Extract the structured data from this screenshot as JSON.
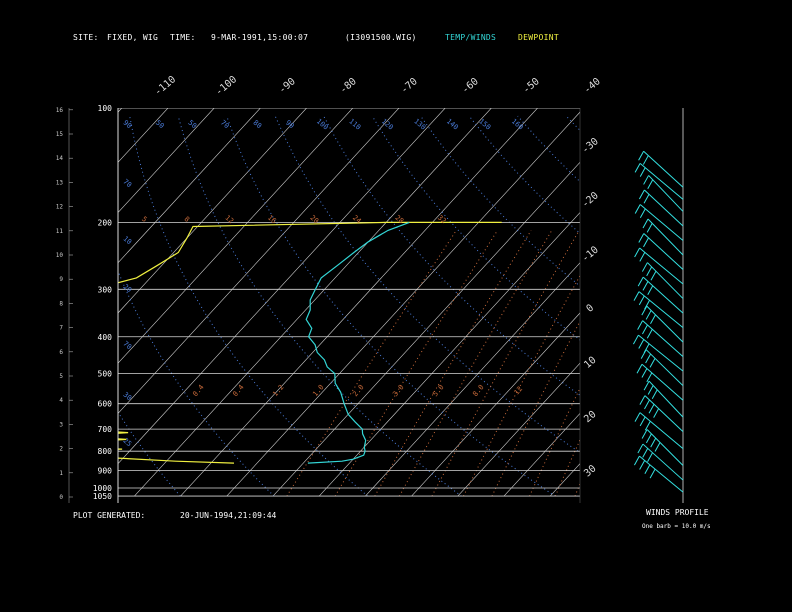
{
  "header": {
    "site_label": "SITE:",
    "site_value": "FIXED, WIG",
    "time_label": "TIME:",
    "time_value": "9-MAR-1991,15:00:07",
    "file_value": "(I3091500.WIG)",
    "temp_winds_label": "TEMP/WINDS",
    "dewpoint_label": "DEWPOINT"
  },
  "footer": {
    "generated_label": "PLOT GENERATED:",
    "generated_value": "20-JUN-1994,21:09:44",
    "winds_profile_label": "WINDS PROFILE",
    "barb_note": "One barb = 10.0 m/s"
  },
  "colors": {
    "background": "#000000",
    "temperature": "#33d6d6",
    "dewpoint": "#f0f040",
    "isobar": "#d8d8d8",
    "isotherm": "#cfcfcf",
    "dry_adiabat": "#4a7bd8",
    "mixing_ratio": "#c86a3a",
    "wind_barb": "#33e0e0"
  },
  "chart_data": {
    "type": "skew-t",
    "pressure_levels_hPa": [
      100,
      200,
      300,
      400,
      500,
      600,
      700,
      800,
      900,
      1000,
      1050
    ],
    "height_km_ticks": [
      0,
      1,
      2,
      3,
      4,
      5,
      6,
      7,
      8,
      9,
      10,
      11,
      12,
      13,
      14,
      15,
      16
    ],
    "isotherm_labels_C": [
      "-110",
      "-100",
      "-90",
      "-80",
      "-70",
      "-60",
      "-50",
      "-40",
      "-30",
      "-20",
      "-10",
      "0",
      "10",
      "20",
      "30"
    ],
    "theta_labels_K": [
      "90",
      "50",
      "50",
      "70",
      "80",
      "90",
      "100",
      "110",
      "120",
      "130",
      "140",
      "150",
      "160"
    ],
    "theta_labels_lower": [
      "70",
      "10",
      "20",
      "70",
      "30",
      "25"
    ],
    "mixing_ratio_labels_upper": [
      "5",
      "8",
      "12",
      "16",
      "20",
      "24",
      "28",
      "32"
    ],
    "mixing_ratio_labels_lower": [
      "0.4",
      "0.4",
      "1.2",
      "1.0",
      "2.0",
      "3.0",
      "5.0",
      "8.0",
      "12"
    ],
    "temperature_profile": [
      {
        "p": 860,
        "t": -29
      },
      {
        "p": 850,
        "t": -22
      },
      {
        "p": 840,
        "t": -20
      },
      {
        "p": 820,
        "t": -18.5
      },
      {
        "p": 800,
        "t": -19
      },
      {
        "p": 780,
        "t": -20
      },
      {
        "p": 750,
        "t": -21
      },
      {
        "p": 720,
        "t": -23
      },
      {
        "p": 700,
        "t": -24
      },
      {
        "p": 670,
        "t": -27
      },
      {
        "p": 640,
        "t": -30
      },
      {
        "p": 600,
        "t": -33
      },
      {
        "p": 560,
        "t": -36
      },
      {
        "p": 530,
        "t": -39
      },
      {
        "p": 500,
        "t": -41
      },
      {
        "p": 480,
        "t": -44
      },
      {
        "p": 460,
        "t": -46
      },
      {
        "p": 440,
        "t": -49
      },
      {
        "p": 420,
        "t": -51
      },
      {
        "p": 400,
        "t": -54
      },
      {
        "p": 380,
        "t": -55
      },
      {
        "p": 360,
        "t": -58
      },
      {
        "p": 340,
        "t": -59
      },
      {
        "p": 320,
        "t": -61
      },
      {
        "p": 300,
        "t": -62
      },
      {
        "p": 280,
        "t": -63
      },
      {
        "p": 260,
        "t": -62
      },
      {
        "p": 240,
        "t": -61
      },
      {
        "p": 225,
        "t": -60
      },
      {
        "p": 210,
        "t": -58
      },
      {
        "p": 200,
        "t": -55
      }
    ],
    "dewpoint_profile": [
      {
        "p": 860,
        "t": -45
      },
      {
        "p": 850,
        "t": -58
      },
      {
        "p": 830,
        "t": -75
      },
      {
        "p": 810,
        "t": -82
      },
      {
        "p": 800,
        "t": -80
      },
      {
        "p": 790,
        "t": -72
      },
      {
        "p": 780,
        "t": -84
      },
      {
        "p": 770,
        "t": -74
      },
      {
        "p": 760,
        "t": -86
      },
      {
        "p": 745,
        "t": -73
      },
      {
        "p": 730,
        "t": -85
      },
      {
        "p": 715,
        "t": -74
      },
      {
        "p": 700,
        "t": -86
      },
      {
        "p": 680,
        "t": -78
      },
      {
        "p": 660,
        "t": -88
      },
      {
        "p": 640,
        "t": -80
      },
      {
        "p": 620,
        "t": -90
      },
      {
        "p": 600,
        "t": -83
      },
      {
        "p": 580,
        "t": -92
      },
      {
        "p": 560,
        "t": -86
      },
      {
        "p": 540,
        "t": -95
      },
      {
        "p": 520,
        "t": -100
      },
      {
        "p": 505,
        "t": -108
      },
      {
        "p": 470,
        "t": -112
      },
      {
        "p": 450,
        "t": -112
      },
      {
        "p": 420,
        "t": -110
      },
      {
        "p": 400,
        "t": -110
      },
      {
        "p": 350,
        "t": -110
      },
      {
        "p": 300,
        "t": -110
      },
      {
        "p": 280,
        "t": -103
      },
      {
        "p": 260,
        "t": -101
      },
      {
        "p": 240,
        "t": -99
      },
      {
        "p": 220,
        "t": -100
      },
      {
        "p": 205,
        "t": -101
      },
      {
        "p": 200,
        "t": -60
      },
      {
        "p": 200,
        "t": -35
      }
    ],
    "wind_profile": [
      {
        "km": 0.2,
        "speed": 40
      },
      {
        "km": 0.7,
        "speed": 35
      },
      {
        "km": 1.3,
        "speed": 40
      },
      {
        "km": 2.0,
        "speed": 35
      },
      {
        "km": 2.7,
        "speed": 40
      },
      {
        "km": 3.3,
        "speed": 30
      },
      {
        "km": 4.0,
        "speed": 35
      },
      {
        "km": 4.6,
        "speed": 30
      },
      {
        "km": 5.2,
        "speed": 30
      },
      {
        "km": 5.8,
        "speed": 35
      },
      {
        "km": 6.4,
        "speed": 30
      },
      {
        "km": 7.0,
        "speed": 30
      },
      {
        "km": 7.6,
        "speed": 35
      },
      {
        "km": 8.2,
        "speed": 30
      },
      {
        "km": 8.8,
        "speed": 25
      },
      {
        "km": 9.4,
        "speed": 25
      },
      {
        "km": 10.0,
        "speed": 25
      },
      {
        "km": 10.6,
        "speed": 25
      },
      {
        "km": 11.2,
        "speed": 25
      },
      {
        "km": 11.8,
        "speed": 25
      },
      {
        "km": 12.3,
        "speed": 20
      },
      {
        "km": 12.8,
        "speed": 20
      }
    ]
  }
}
